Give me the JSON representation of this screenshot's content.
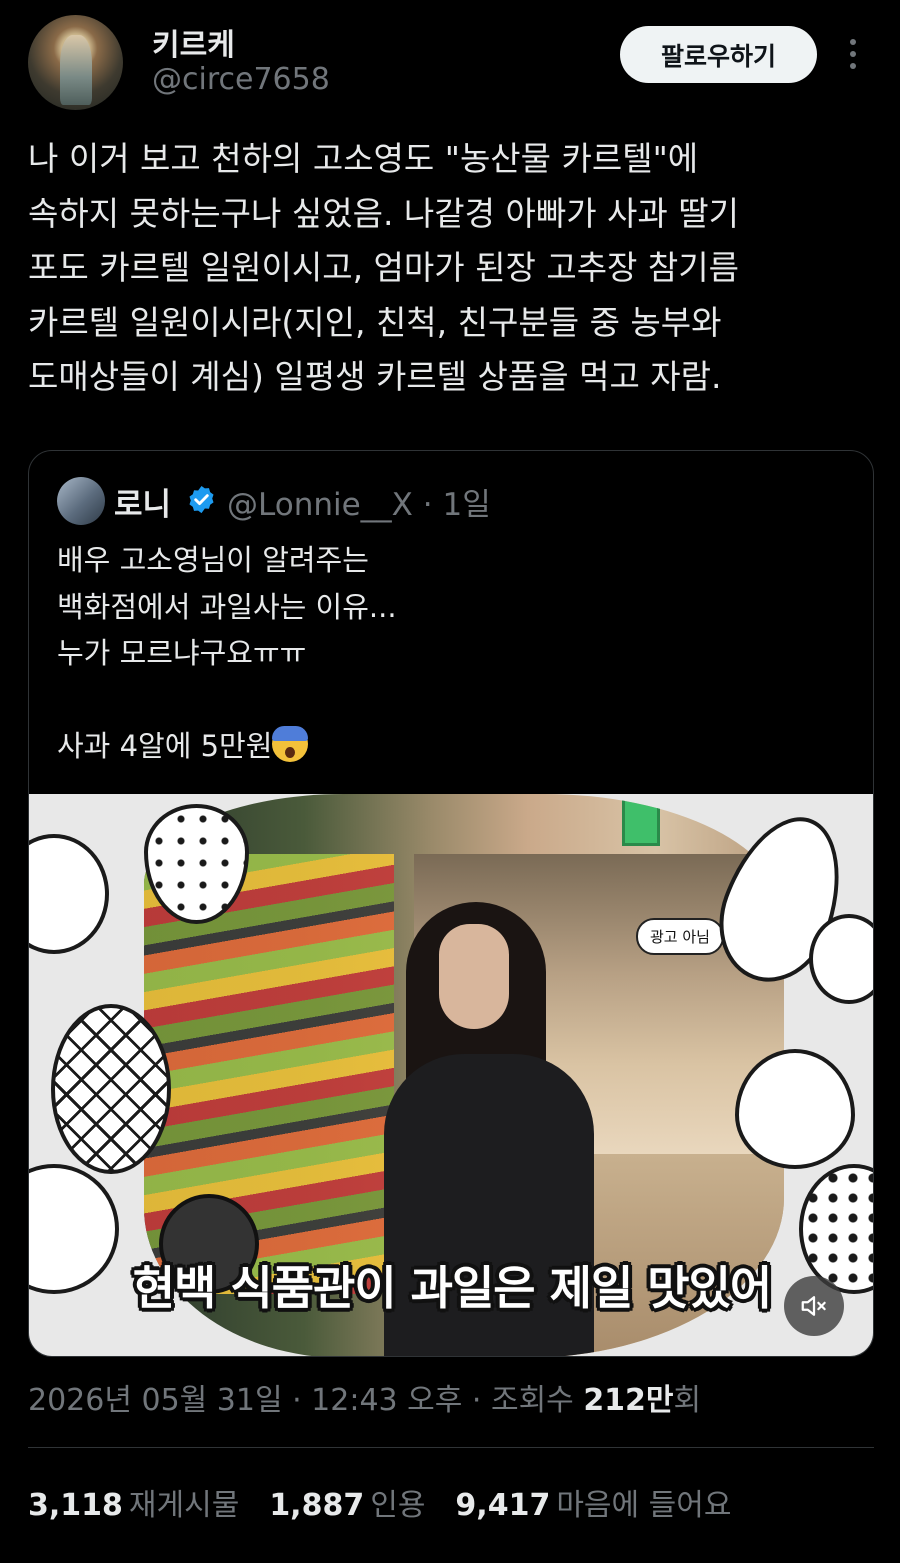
{
  "author": {
    "name": "키르케",
    "handle": "@circe7658",
    "follow_label": "팔로우하기"
  },
  "tweet": {
    "lines": [
      "나 이거 보고 천하의 고소영도 \"농산물 카르텔\"에",
      "속하지 못하는구나 싶었음. 나같경 아빠가 사과 딸기",
      "포도 카르텔 일원이시고, 엄마가 된장 고추장 참기름",
      "카르텔 일원이시라(지인, 친척, 친구분들 중 농부와",
      "도매상들이 계심) 일평생 카르텔 상품을 먹고 자람."
    ]
  },
  "quote": {
    "name": "로니",
    "handle_time": "@Lonnie__X · 1일",
    "lines": [
      "배우 고소영님이 알려주는",
      "백화점에서 과일사는 이유...",
      "누가 모르냐구요ㅠㅠ",
      "",
      "사과 4알에 5만원"
    ],
    "emoji": "face-screaming-in-fear",
    "video": {
      "bubble": "광고 아님",
      "caption": "현백 식품관이 과일은 제일 맛있어"
    }
  },
  "meta": {
    "date": "2026년 05월 31일 · 12:43 오후 · 조회수 ",
    "views": "212만",
    "views_suffix": "회"
  },
  "stats": {
    "retweets": "3,118",
    "retweets_label": "재게시물",
    "quotes": "1,887",
    "quotes_label": "인용",
    "likes": "9,417",
    "likes_label": "마음에 들어요"
  },
  "colors": {
    "background": "#000000",
    "text": "#e7e9ea",
    "secondary": "#71767b",
    "verified": "#1d9bf0",
    "border": "#2f3336"
  }
}
